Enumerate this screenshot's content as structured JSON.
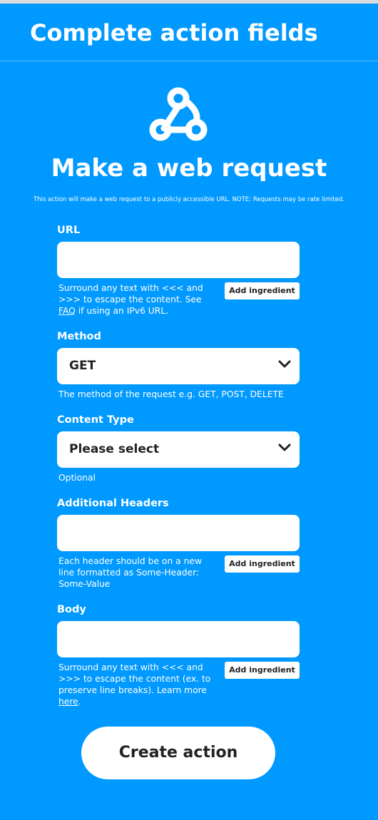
{
  "header": {
    "title": "Complete action fields"
  },
  "service": {
    "icon": "webhook-icon",
    "title": "Make a web request",
    "description": "This action will make a web request to a publicly accessible URL. NOTE: Requests may be rate limited."
  },
  "fields": {
    "url": {
      "label": "URL",
      "value": "",
      "helper_pre": "Surround any text with <<< and >>> to escape the content. See ",
      "helper_link": "FAQ",
      "helper_post": " if using an IPv6 URL.",
      "ingredient_label": "Add ingredient"
    },
    "method": {
      "label": "Method",
      "value": "GET",
      "helper": "The method of the request e.g. GET, POST, DELETE"
    },
    "content_type": {
      "label": "Content Type",
      "value": "Please select",
      "helper": "Optional"
    },
    "headers": {
      "label": "Additional Headers",
      "value": "",
      "helper": "Each header should be on a new line formatted as Some-Header: Some-Value",
      "ingredient_label": "Add ingredient"
    },
    "body": {
      "label": "Body",
      "value": "",
      "helper_pre": "Surround any text with <<< and >>> to escape the content (ex. to preserve line breaks). Learn more ",
      "helper_link": "here",
      "helper_post": ".",
      "ingredient_label": "Add ingredient"
    }
  },
  "submit": {
    "label": "Create action"
  },
  "colors": {
    "background": "#0099ff",
    "surface": "#ffffff",
    "text_dark": "#222222"
  }
}
